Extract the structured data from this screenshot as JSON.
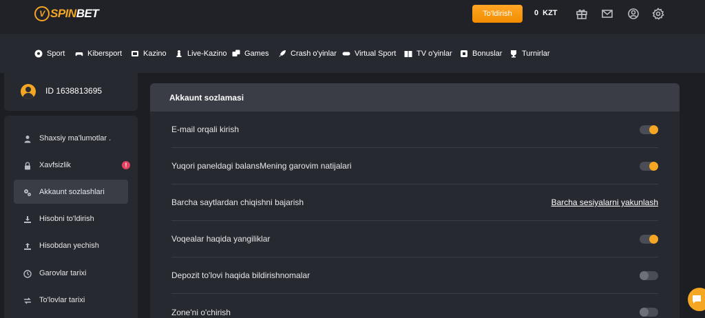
{
  "brand": {
    "mark": "V",
    "name_a": "SPIN",
    "name_b": "BET",
    "accent": "#f5a623"
  },
  "header": {
    "deposit_label": "To'ldirish",
    "balance_amount": "0",
    "balance_currency": "KZT",
    "icons": [
      "gift-icon",
      "mail-icon",
      "user-icon",
      "gear-icon"
    ]
  },
  "nav": {
    "items": [
      {
        "label": "Sport",
        "icon": "soccer-ball-icon"
      },
      {
        "label": "Kibersport",
        "icon": "gamepad-icon"
      },
      {
        "label": "Kazino",
        "icon": "casino-icon"
      },
      {
        "label": "Live-Kazino",
        "icon": "chess-piece-icon"
      },
      {
        "label": "Games",
        "icon": "dice-icon"
      },
      {
        "label": "Crash o'yinlar",
        "icon": "rocket-icon"
      },
      {
        "label": "Virtual Sport",
        "icon": "vr-icon"
      },
      {
        "label": "TV o'yinlar",
        "icon": "tv-icon"
      },
      {
        "label": "Bonuslar",
        "icon": "bonus-icon"
      },
      {
        "label": "Turnirlar",
        "icon": "tournament-icon"
      }
    ]
  },
  "profile": {
    "id_label": "ID 1638813695"
  },
  "sidebar": {
    "items": [
      {
        "label": "Shaxsiy ma'lumotlar .",
        "icon": "user-icon"
      },
      {
        "label": "Xavfsizlik",
        "icon": "lock-icon",
        "badge": "!"
      },
      {
        "label": "Akkaunt sozlashlari",
        "icon": "settings-icon",
        "active": true
      },
      {
        "label": "Hisobni to'ldirish",
        "icon": "download-icon"
      },
      {
        "label": "Hisobdan yechish",
        "icon": "upload-icon"
      },
      {
        "label": "Garovlar tarixi",
        "icon": "clock-icon"
      },
      {
        "label": "To'lovlar tarixi",
        "icon": "transfer-icon"
      }
    ]
  },
  "panel": {
    "title": "Akkaunt sozlamasi",
    "rows": [
      {
        "label": "E-mail orqali kirish",
        "type": "toggle",
        "on": true
      },
      {
        "label": "Yuqori paneldagi balansMening garovim natijalari",
        "type": "toggle",
        "on": true
      },
      {
        "label": "Barcha saytlardan chiqishni bajarish",
        "type": "link",
        "action": "Barcha sesiyalarni yakunlash"
      },
      {
        "label": "Voqealar haqida yangiliklar",
        "type": "toggle",
        "on": true
      },
      {
        "label": "Depozit to'lovi haqida bildirishnomalar",
        "type": "toggle",
        "on": false
      },
      {
        "label": "Zone'ni o'chirish",
        "type": "toggle",
        "on": false
      }
    ]
  }
}
